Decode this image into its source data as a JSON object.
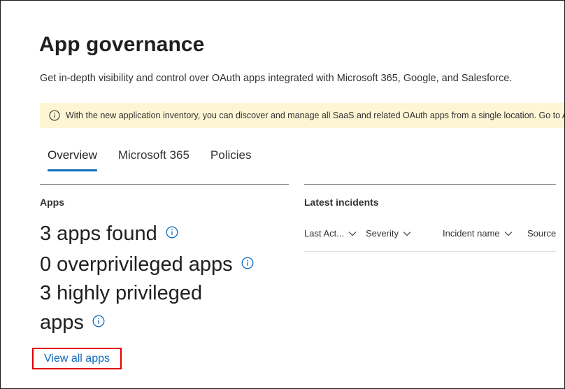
{
  "header": {
    "title": "App governance",
    "subtitle": "Get in-depth visibility and control over OAuth apps integrated with Microsoft 365, Google, and Salesforce."
  },
  "banner": {
    "icon": "info-icon",
    "text": "With the new application inventory, you can discover and manage all SaaS and related OAuth apps from a single location. Go to App..."
  },
  "tabs": [
    {
      "label": "Overview",
      "active": true
    },
    {
      "label": "Microsoft 365",
      "active": false
    },
    {
      "label": "Policies",
      "active": false
    }
  ],
  "apps_section": {
    "label": "Apps",
    "stats": [
      {
        "text": "3 apps found"
      },
      {
        "text": "0 overprivileged apps"
      },
      {
        "line1": "3 highly privileged",
        "line2": "apps"
      }
    ],
    "view_all_label": "View all apps"
  },
  "incidents_section": {
    "label": "Latest incidents",
    "columns": [
      "Last Act...",
      "Severity",
      "Incident name",
      "Source"
    ]
  },
  "colors": {
    "accent": "#0f6cbd",
    "banner_bg": "#fdf6d5",
    "highlight_box": "#e00000"
  }
}
